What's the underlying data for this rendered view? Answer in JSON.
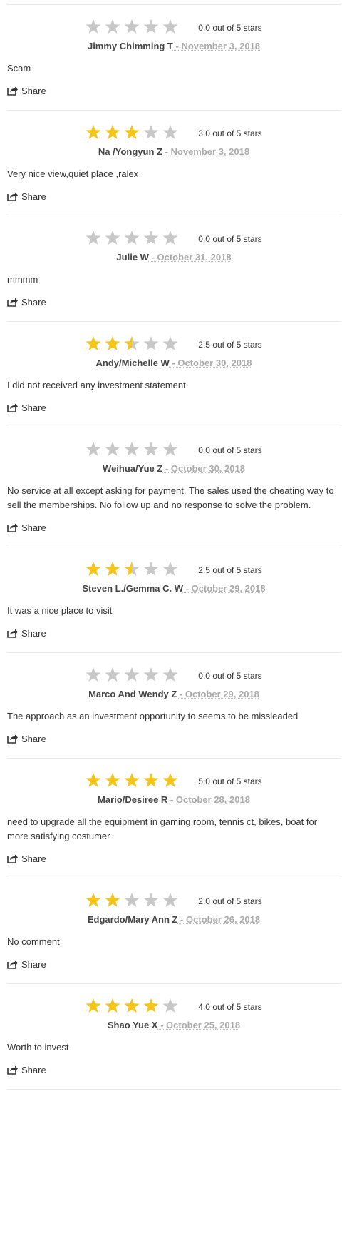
{
  "colors": {
    "star_filled": "#f5c518",
    "star_empty": "#c8c8c8",
    "divider": "#e8e8e8",
    "date": "#aaaaaa"
  },
  "share_label": "Share",
  "reviews": [
    {
      "rating": 0,
      "rating_text": "0.0 out of 5 stars",
      "author": "Jimmy Chimming T",
      "date": " - November 3, 2018",
      "text": "Scam"
    },
    {
      "rating": 3,
      "rating_text": "3.0 out of 5 stars",
      "author": "Na /Yongyun Z",
      "date": " - November 3, 2018",
      "text": "Very nice view,quiet place ,ralex"
    },
    {
      "rating": 0,
      "rating_text": "0.0 out of 5 stars",
      "author": "Julie W",
      "date": " - October 31, 2018",
      "text": "mmmm"
    },
    {
      "rating": 2.5,
      "rating_text": "2.5 out of 5 stars",
      "author": "Andy/Michelle W",
      "date": " - October 30, 2018",
      "text": "I did not received any investment statement"
    },
    {
      "rating": 0,
      "rating_text": "0.0 out of 5 stars",
      "author": "Weihua/Yue Z",
      "date": " - October 30, 2018",
      "text": "No service at all except asking for payment. The sales used the cheating way to sell the memberships. No follow up and no response to solve the problem."
    },
    {
      "rating": 2.5,
      "rating_text": "2.5 out of 5 stars",
      "author": "Steven L./Gemma C. W",
      "date": " - October 29, 2018",
      "text": "It was a nice place to visit"
    },
    {
      "rating": 0,
      "rating_text": "0.0 out of 5 stars",
      "author": "Marco And Wendy Z",
      "date": " - October 29, 2018",
      "text": "The approach as an investment opportunity to seems to be missleaded"
    },
    {
      "rating": 5,
      "rating_text": "5.0 out of 5 stars",
      "author": "Mario/Desiree R",
      "date": " - October 28, 2018",
      "text": "need to upgrade all the equipment in gaming room, tennis ct, bikes, boat for more satisfying costumer"
    },
    {
      "rating": 2,
      "rating_text": "2.0 out of 5 stars",
      "author": "Edgardo/Mary Ann Z",
      "date": " - October 26, 2018",
      "text": "No comment"
    },
    {
      "rating": 4,
      "rating_text": "4.0 out of 5 stars",
      "author": "Shao Yue X",
      "date": " - October 25, 2018",
      "text": "Worth to invest"
    }
  ]
}
